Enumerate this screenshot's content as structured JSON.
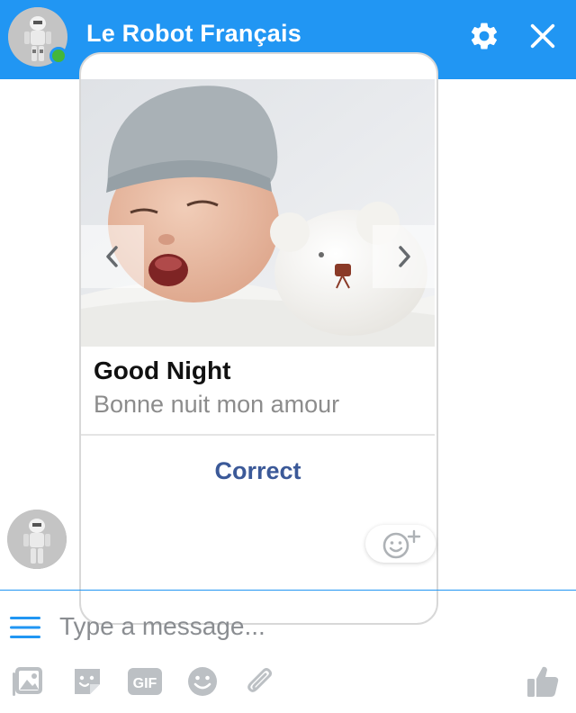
{
  "header": {
    "title": "Le Robot Français",
    "status": "online",
    "icons": {
      "settings": "gear-icon",
      "close": "close-icon"
    }
  },
  "message_card": {
    "title": "Good Night",
    "subtitle": "Bonne nuit mon amour",
    "action_label": "Correct",
    "carousel": {
      "prev_icon": "chevron-left-icon",
      "next_icon": "chevron-right-icon"
    },
    "react_icon": "smiley-add-icon"
  },
  "composer": {
    "placeholder": "Type a message...",
    "value": "",
    "menu_icon": "hamburger-menu-icon",
    "tools": [
      {
        "name": "image",
        "icon": "image-icon"
      },
      {
        "name": "sticker",
        "icon": "sticker-icon"
      },
      {
        "name": "gif",
        "icon": "gif-icon",
        "label": "GIF"
      },
      {
        "name": "emoji",
        "icon": "emoji-icon"
      },
      {
        "name": "attach",
        "icon": "paperclip-icon"
      },
      {
        "name": "like",
        "icon": "thumbs-up-icon"
      }
    ]
  },
  "colors": {
    "brand_blue": "#2196f3",
    "online_green": "#43b63a",
    "action_text": "#3b5998",
    "icon_gray": "#bcc0c4"
  }
}
